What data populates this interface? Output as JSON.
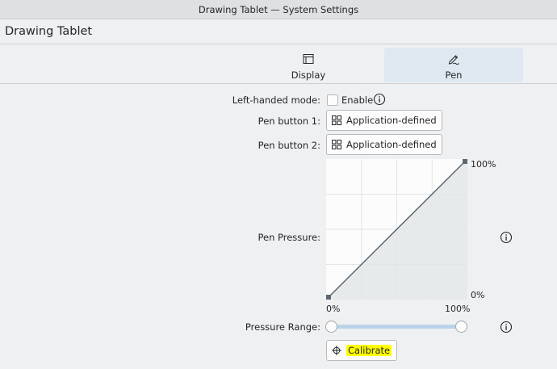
{
  "window": {
    "title": "Drawing Tablet — System Settings"
  },
  "header": {
    "title": "Drawing Tablet"
  },
  "tabs": [
    {
      "label": "Display",
      "icon": "display-icon",
      "active": false
    },
    {
      "label": "Pen",
      "icon": "pen-icon",
      "active": true
    }
  ],
  "form": {
    "left_handed": {
      "label": "Left-handed mode:",
      "checkbox_label": "Enable",
      "checked": false
    },
    "pen_button_1": {
      "label": "Pen button 1:",
      "value": "Application-defined"
    },
    "pen_button_2": {
      "label": "Pen button 2:",
      "value": "Application-defined"
    },
    "pen_pressure": {
      "label": "Pen Pressure:"
    },
    "pressure_range": {
      "label": "Pressure Range:",
      "min": 0,
      "max": 1
    },
    "calibrate_label": "Calibrate"
  },
  "chart_data": {
    "type": "area",
    "title": "",
    "x": [
      0,
      100
    ],
    "y": [
      0,
      100
    ],
    "xlim": [
      0,
      100
    ],
    "ylim": [
      0,
      100
    ],
    "x_tick_labels": [
      "0%",
      "100%"
    ],
    "y_tick_labels": [
      "0%",
      "100%"
    ],
    "grid": true
  },
  "colors": {
    "accent": "#3daee9",
    "highlight": "#ffff00",
    "curve": "#5b6770",
    "fill": "#e3e6e8"
  }
}
